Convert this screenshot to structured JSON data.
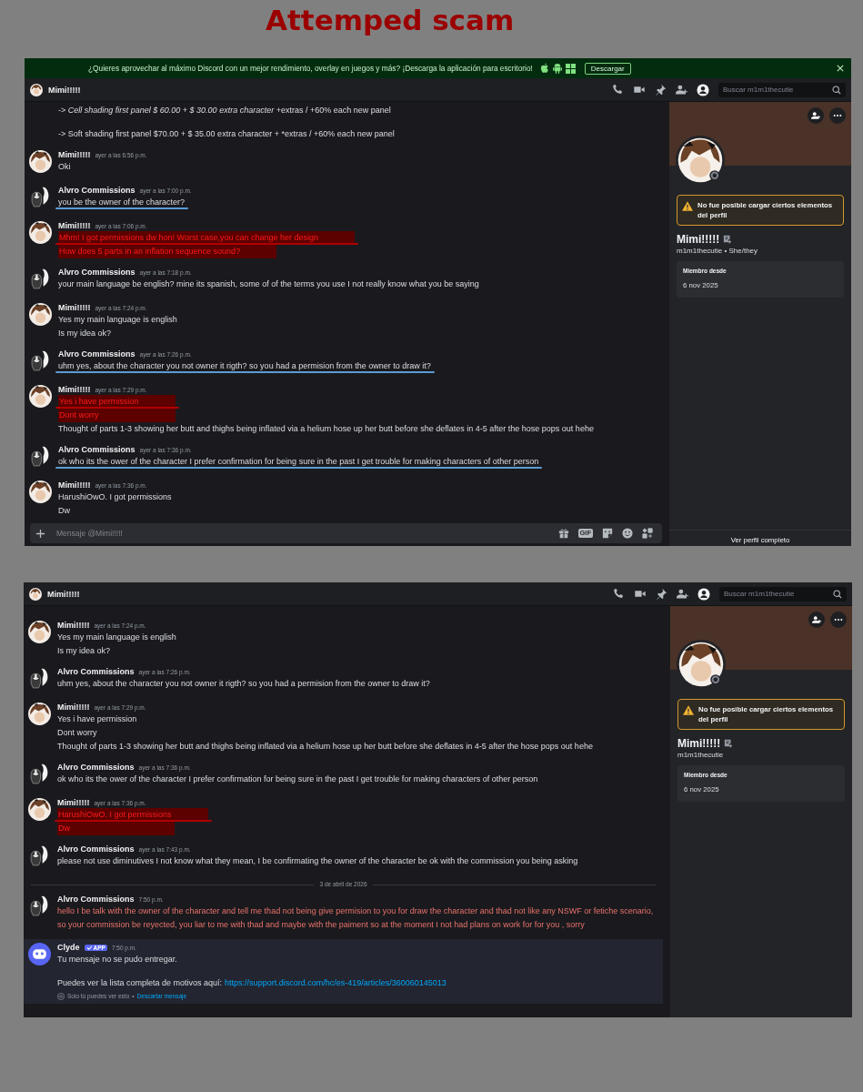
{
  "title": "Attemped scam",
  "screens": [
    {
      "banner": {
        "text": "¿Quieres aprovechar al máximo Discord con un mejor rendimiento, overlay en juegos y más? ¡Descarga la aplicación para escritorio!",
        "button": "Descargar"
      },
      "header": {
        "name": "Mimi!!!!!",
        "search_placeholder": "Buscar m1m1thecutie"
      },
      "messages": [
        {
          "kind": "message",
          "lines": [
            {
              "text": "-> *Cell shading first panel $ 60.00 + $ 30.00 extra character* +extras / +60% each new panel",
              "highlight": false
            },
            {
              "text": "-> Soft shading first panel $70.00 + $ 35.00 extra character + *extras / +60% each new panel",
              "highlight": false,
              "spaced": true
            }
          ]
        },
        {
          "kind": "message",
          "avatar": {
            "kind": "girl"
          },
          "author": "Mimi!!!!!",
          "time": "ayer a las 6:56 p.m.",
          "failed": false,
          "lines": [
            {
              "text": "Oki",
              "highlight": false
            }
          ]
        },
        {
          "kind": "message",
          "avatar": {
            "kind": "skunk"
          },
          "author": "Alvro Commissions",
          "time": "ayer a las 7:00 p.m.",
          "failed": false,
          "lines": [
            {
              "text": "you be the owner of the character?",
              "highlight": false,
              "underline": true,
              "color": "#5b9bd5"
            }
          ]
        },
        {
          "kind": "message",
          "avatar": {
            "kind": "girl"
          },
          "author": "Mimi!!!!!",
          "time": "ayer a las 7:06 p.m.",
          "failed": false,
          "lines": [
            {
              "text": "Mhm! I got permissions dw hon! Worst case,you can change her design",
              "highlight": true,
              "underline": true,
              "color": "#b00000"
            },
            {
              "text": "How does 5 parts in an inflation sequence sound?",
              "highlight": true,
              "underline": false
            }
          ]
        },
        {
          "kind": "message",
          "avatar": {
            "kind": "skunk"
          },
          "author": "Alvro Commissions",
          "time": "ayer a las 7:18 p.m.",
          "failed": false,
          "lines": [
            {
              "text": "your main language be english? mine its spanish, some of of the terms you use I not really know what you be saying",
              "highlight": false,
              "underline": false
            }
          ]
        },
        {
          "kind": "message",
          "avatar": {
            "kind": "girl"
          },
          "author": "Mimi!!!!!",
          "time": "ayer a las 7:24 p.m.",
          "failed": false,
          "lines": [
            {
              "text": "Yes my main language is english",
              "highlight": false,
              "underline": false
            },
            {
              "text": "Is my idea ok?",
              "highlight": false,
              "underline": false
            }
          ]
        },
        {
          "kind": "message",
          "avatar": {
            "kind": "skunk"
          },
          "author": "Alvro Commissions",
          "time": "ayer a las 7:26 p.m.",
          "failed": false,
          "lines": [
            {
              "text": "uhm yes, about the character you not owner it rigth? so you had a permision from the owner to draw it?",
              "highlight": false,
              "underline": true,
              "color": "#5b9bd5"
            }
          ]
        },
        {
          "kind": "message",
          "avatar": {
            "kind": "girl"
          },
          "author": "Mimi!!!!!",
          "time": "ayer a las 7:29 p.m.",
          "failed": false,
          "lines": [
            {
              "text": "Yes i have permission",
              "highlight": true,
              "underline": true,
              "color": "#b00000"
            },
            {
              "text": "Dont worry",
              "highlight": true,
              "underline": false
            },
            {
              "text": "Thought of parts 1-3 showing her butt and thighs being inflated via a helium hose up her butt before she deflates in 4-5 after the hose pops out hehe",
              "highlight": false,
              "underline": false
            }
          ]
        },
        {
          "kind": "message",
          "avatar": {
            "kind": "skunk"
          },
          "author": "Alvro Commissions",
          "time": "ayer a las 7:36 p.m.",
          "failed": false,
          "lines": [
            {
              "text": "ok who its the ower of the character I prefer confirmation for being sure in the past I get trouble for making characters of other person",
              "highlight": false,
              "underline": true,
              "color": "#5b9bd5"
            }
          ]
        },
        {
          "kind": "message",
          "avatar": {
            "kind": "girl"
          },
          "author": "Mimi!!!!!",
          "time": "ayer a las 7:36 p.m.",
          "failed": false,
          "lines": [
            {
              "text": "HarushiOwO. I got permissions",
              "highlight": false,
              "underline": false
            },
            {
              "text": "Dw",
              "highlight": false,
              "underline": false
            }
          ]
        }
      ],
      "composer": {
        "placeholder": "Mensaje @Mimi!!!!!",
        "gif": "GIF"
      },
      "profile": {
        "warning": "No fue posible cargar ciertos elementos del perfil",
        "name": "Mimi!!!!!",
        "handle": "m1m1thecutie • She/they",
        "member_label": "Miembro desde",
        "member_since": "6 nov 2025",
        "full_profile": "Ver perfil completo"
      }
    },
    {
      "header": {
        "name": "Mimi!!!!!",
        "search_placeholder": "Buscar m1m1thecutie"
      },
      "messages": [
        {
          "kind": "message",
          "avatar": {
            "kind": "girl"
          },
          "author": "Mimi!!!!!",
          "time": "ayer a las 7:24 p.m.",
          "failed": false,
          "lines": [
            {
              "text": "Yes my main language is english",
              "highlight": false
            },
            {
              "text": "Is my idea ok?",
              "highlight": false
            }
          ]
        },
        {
          "kind": "message",
          "avatar": {
            "kind": "skunk"
          },
          "author": "Alvro Commissions",
          "time": "ayer a las 7:26 p.m.",
          "failed": false,
          "lines": [
            {
              "text": "uhm yes, about the character you not owner it rigth? so you had a permision from the owner to draw it?",
              "highlight": false
            }
          ]
        },
        {
          "kind": "message",
          "avatar": {
            "kind": "girl"
          },
          "author": "Mimi!!!!!",
          "time": "ayer a las 7:29 p.m.",
          "failed": false,
          "lines": [
            {
              "text": "Yes i have permission",
              "highlight": false
            },
            {
              "text": "Dont worry",
              "highlight": false
            },
            {
              "text": "Thought of parts 1-3 showing her butt and thighs being inflated via a helium hose up her butt before she deflates in 4-5 after the hose pops out hehe",
              "highlight": false
            }
          ]
        },
        {
          "kind": "message",
          "avatar": {
            "kind": "skunk"
          },
          "author": "Alvro Commissions",
          "time": "ayer a las 7:36 p.m.",
          "failed": false,
          "lines": [
            {
              "text": "ok who its the ower of the character I prefer confirmation for being sure in the past I get trouble for making characters of other person",
              "highlight": false
            }
          ]
        },
        {
          "kind": "message",
          "avatar": {
            "kind": "girl"
          },
          "author": "Mimi!!!!!",
          "time": "ayer a las 7:36 p.m.",
          "failed": false,
          "lines": [
            {
              "text": "HarushiOwO. I got permissions",
              "highlight": true,
              "underline": true,
              "color": "#b00000"
            },
            {
              "text": "Dw",
              "highlight": true,
              "underline": false
            }
          ]
        },
        {
          "kind": "message",
          "avatar": {
            "kind": "skunk"
          },
          "author": "Alvro Commissions",
          "time": "ayer a las 7:43 p.m.",
          "failed": false,
          "lines": [
            {
              "text": "please not use diminutives I not know what they mean, I be confirmating  the owner of the character be ok with the commission you being asking",
              "highlight": false
            }
          ]
        },
        {
          "kind": "divider",
          "text": "3 de abril de 2026"
        },
        {
          "kind": "message",
          "avatar": {
            "kind": "skunk"
          },
          "author": "Alvro Commissions",
          "time": "7:50 p.m.",
          "failed": true,
          "lines": [
            {
              "text": "hello I be talk with the owner of the character and tell me thad not being give permision to you for draw the character and thad not like any NSWF or fetiche scenario, so your commission be reyected, you liar to me with thad and maybe with the paiment so at the moment I not had plans on work for for you , sorry",
              "highlight": false
            }
          ]
        },
        {
          "kind": "system",
          "avatar": {
            "kind": "bot"
          },
          "author": "Clyde",
          "badge": "APP",
          "time": "7:50 p.m.",
          "failed": false,
          "lines": [
            {
              "text": "Tu mensaje no se pudo entregar.",
              "highlight": false
            },
            {
              "text": "Puedes ver la lista completa de motivos aquí:",
              "link": "https://support.discord.com/hc/es-419/articles/360060145013",
              "highlight": false,
              "spaced": true
            }
          ],
          "footer": {
            "note": "Solo tú puedes ver esto",
            "separator": "•",
            "action": "Descartar mensaje"
          }
        }
      ],
      "profile": {
        "warning": "No fue posible cargar ciertos elementos del perfil",
        "name": "Mimi!!!!!",
        "handle": "m1m1thecutie",
        "member_label": "Miembro desde",
        "member_since": "6 nov 2025"
      }
    }
  ]
}
